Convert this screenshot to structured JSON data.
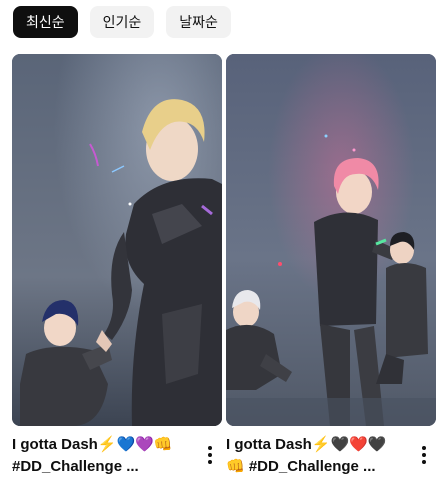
{
  "filters": {
    "latest": "최신순",
    "popular": "인기순",
    "date": "날짜순"
  },
  "videos": [
    {
      "title_line1": "I gotta Dash⚡💙💜👊",
      "title_line2": "#DD_Challenge ..."
    },
    {
      "title_line1": "I gotta Dash⚡🖤❤️🖤",
      "title_line2": "👊 #DD_Challenge ..."
    }
  ],
  "colors": {
    "chip_active_bg": "#0f0f0f",
    "chip_bg": "#f2f2f2",
    "text": "#0f0f0f"
  }
}
